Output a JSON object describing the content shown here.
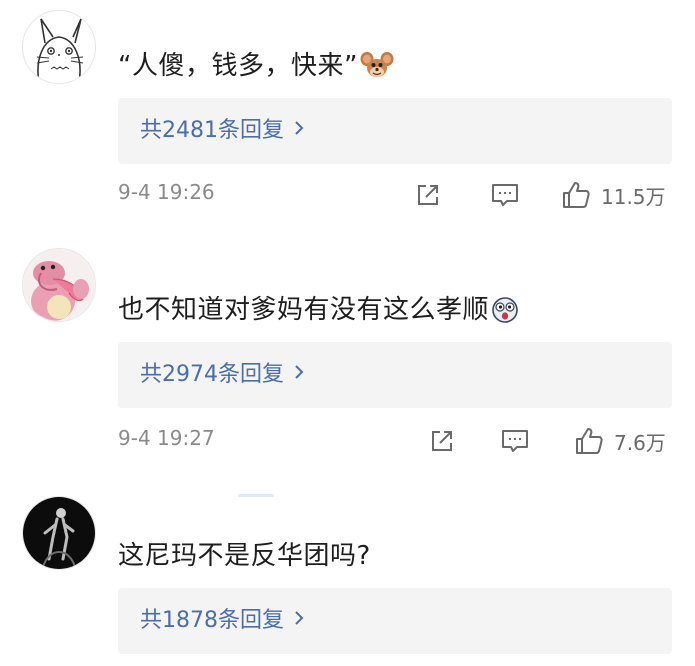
{
  "comments": [
    {
      "avatar": "totoro-sketch-avatar",
      "text": "“人傻，钱多，快来”",
      "emoji": "jerry-mouse-emoji",
      "replies_label": "共2481条回复",
      "timestamp": "9-4 19:26",
      "likes": "11.5万"
    },
    {
      "avatar": "pink-pokemon-avatar",
      "text": "也不知道对爹妈有没有这么孝顺",
      "emoji": "shocked-face-emoji",
      "replies_label": "共2974条回复",
      "timestamp": "9-4 19:27",
      "likes": "7.6万"
    },
    {
      "avatar": "dark-figure-avatar",
      "text": "这尼玛不是反华团吗?",
      "replies_label": "共1878条回复"
    }
  ],
  "icons": {
    "share": "share-icon",
    "comment": "comment-icon",
    "like": "thumbs-up-icon",
    "replies_arrow": "chevron-right-icon"
  },
  "colors": {
    "link": "#4a6ea8",
    "reply_bg": "#f4f4f4",
    "meta": "#8a8a8a"
  }
}
